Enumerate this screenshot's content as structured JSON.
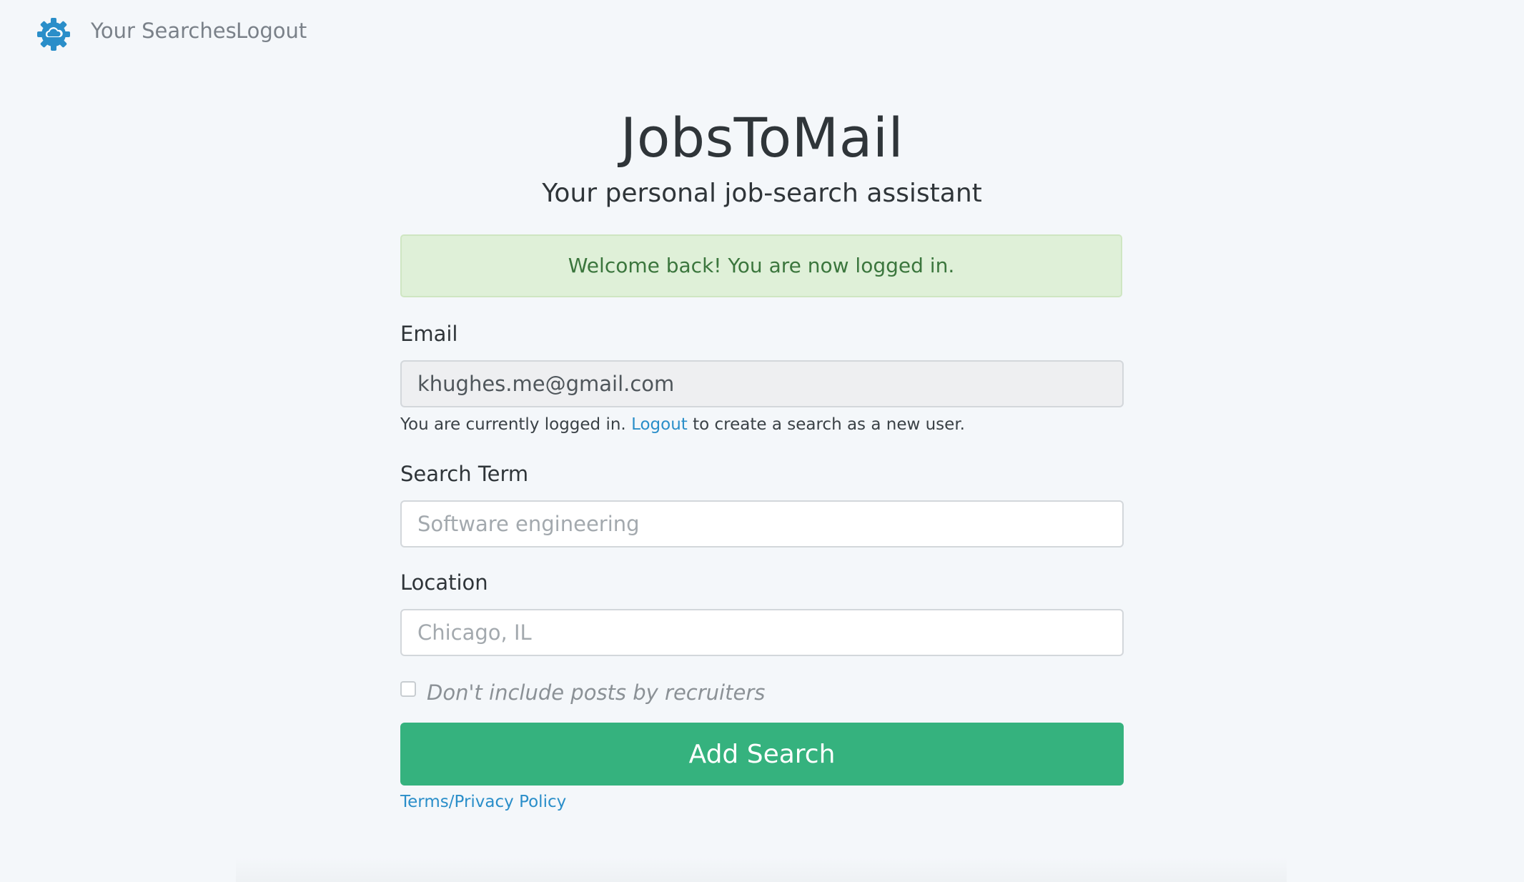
{
  "colors": {
    "brand_blue": "#2a8ec9",
    "accent_green": "#35b27e",
    "alert_bg": "#dff0d8",
    "alert_text": "#3b763d",
    "page_bg": "#f4f7fa"
  },
  "nav": {
    "logo_icon": "gear-cloud-icon",
    "links": [
      {
        "label": "Your Searches"
      },
      {
        "label": "Logout"
      }
    ]
  },
  "header": {
    "title": "JobsToMail",
    "subtitle": "Your personal job-search assistant"
  },
  "alert": {
    "message": "Welcome back! You are now logged in."
  },
  "form": {
    "email": {
      "label": "Email",
      "value": "khughes.me@gmail.com",
      "help_prefix": "You are currently logged in.",
      "help_link": "Logout",
      "help_suffix": "to create a search as a new user."
    },
    "search_term": {
      "label": "Search Term",
      "placeholder": "Software engineering"
    },
    "location": {
      "label": "Location",
      "placeholder": "Chicago, IL"
    },
    "no_recruiters": {
      "label": "Don't include posts by recruiters",
      "checked": false
    },
    "submit_label": "Add Search",
    "terms_link": "Terms/Privacy Policy"
  }
}
